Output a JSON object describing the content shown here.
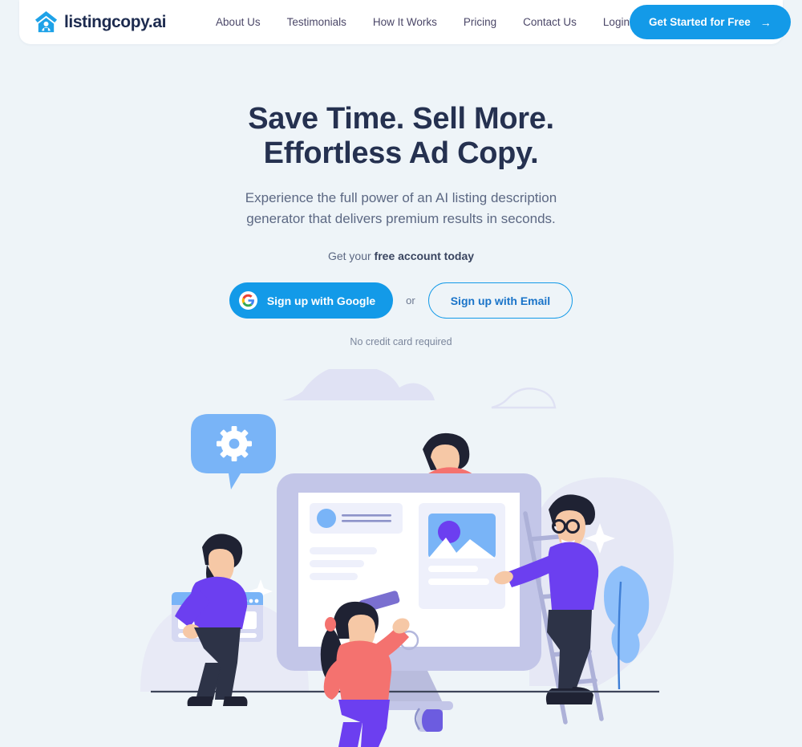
{
  "brand": {
    "name": "listingcopy.ai",
    "logo_icon": "house-logo-icon",
    "logo_color": "#1ea2e8"
  },
  "header": {
    "nav": [
      {
        "label": "About Us",
        "name": "nav-about-us"
      },
      {
        "label": "Testimonials",
        "name": "nav-testimonials"
      },
      {
        "label": "How It Works",
        "name": "nav-how-it-works"
      },
      {
        "label": "Pricing",
        "name": "nav-pricing"
      },
      {
        "label": "Contact Us",
        "name": "nav-contact-us"
      },
      {
        "label": "Login",
        "name": "nav-login"
      }
    ],
    "cta": {
      "label": "Get Started for Free",
      "arrow": "→",
      "bg_color": "#139ae8"
    }
  },
  "hero": {
    "headline_line1": "Save Time. Sell More.",
    "headline_line2": "Effortless Ad Copy.",
    "subhead_line1": "Experience the full power of an AI listing description",
    "subhead_line2": "generator that delivers premium results in seconds.",
    "getyour_prefix": "Get your ",
    "getyour_bold": "free account today",
    "google_button": "Sign up with Google",
    "or": "or",
    "email_button": "Sign up with Email",
    "no_card": "No credit card required"
  },
  "colors": {
    "page_bg": "#eef4f8",
    "accent_blue": "#139ae8",
    "headline": "#253150",
    "body_text": "#5c6883",
    "purple": "#6c3ff0",
    "coral": "#f4726f",
    "lavender": "#c3c6e8",
    "light_blue": "#79b4f7"
  },
  "illustration": {
    "name": "team-building-website-illustration",
    "elements": [
      "cloud-large",
      "cloud-small",
      "gear-speech-bubble",
      "desktop-monitor",
      "person-coral-shirt-peeking",
      "person-with-ladder-purple-shirt",
      "person-bearded-carrying-browser-window",
      "person-woman-with-paint-roller",
      "blue-leaf-plant",
      "paint-bucket",
      "ladder",
      "ground-line",
      "sparkles"
    ]
  }
}
